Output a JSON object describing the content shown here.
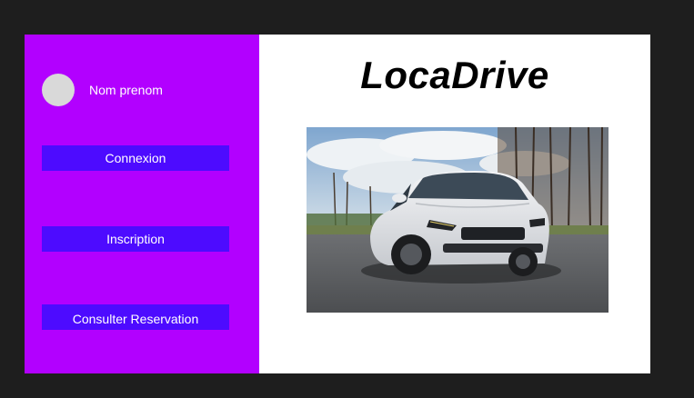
{
  "app": {
    "title": "LocaDrive"
  },
  "sidebar": {
    "user_name": "Nom prenom",
    "buttons": {
      "connexion": "Connexion",
      "inscription": "Inscription",
      "consulter_reservation": "Consulter Reservation"
    }
  },
  "main": {
    "hero_image": "white-suv-car-photo"
  },
  "colors": {
    "sidebar_bg": "#b200ff",
    "button_bg": "#4d0bff",
    "avatar": "#d9d9d9",
    "canvas_bg": "#1e1e1e"
  }
}
